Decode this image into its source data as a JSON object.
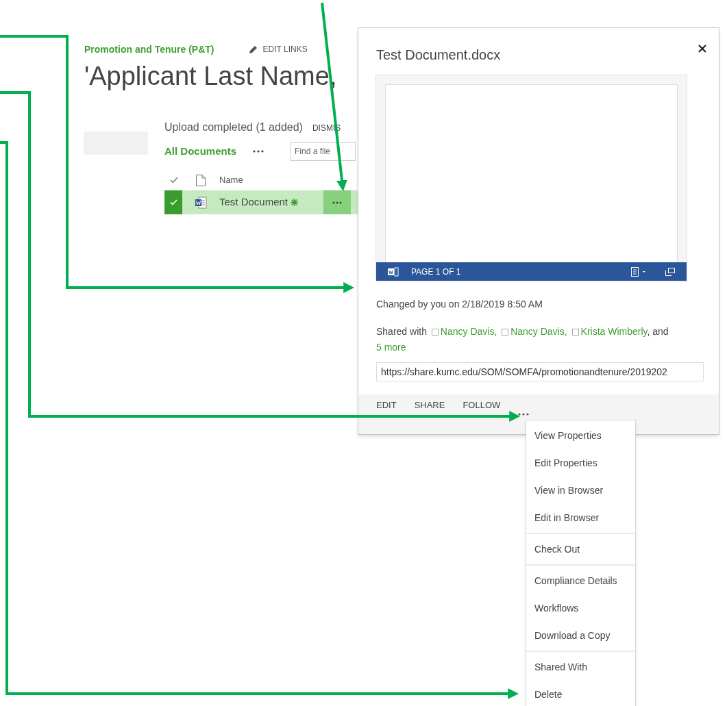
{
  "breadcrumb": {
    "site_link": "Promotion and Tenure (P&T)",
    "edit_links": "EDIT LINKS"
  },
  "page_title": "'Applicant Last Name,",
  "upload_status": {
    "message": "Upload completed (1 added)",
    "dismiss": "DISMIS"
  },
  "view": {
    "name": "All Documents",
    "search": {
      "placeholder": "Find a file"
    }
  },
  "table": {
    "columns": [
      "Name"
    ],
    "rows": [
      {
        "name": "Test Document",
        "selected": true,
        "new": true
      }
    ]
  },
  "callout": {
    "title": "Test Document.docx",
    "preview": {
      "page_label": "PAGE 1 OF 1"
    },
    "changed": "Changed by you on 2/18/2019 8:50 AM",
    "shared": {
      "prefix": "Shared with",
      "people": [
        "Nancy Davis,",
        "Nancy Davis,",
        "Krista Wimberly"
      ],
      "suffix": ", and",
      "more": "5 more"
    },
    "url": "https://share.kumc.edu/SOM/SOMFA/promotionandtenure/2019202",
    "actions": [
      "EDIT",
      "SHARE",
      "FOLLOW"
    ]
  },
  "menu": {
    "groups": [
      [
        "View Properties",
        "Edit Properties",
        "View in Browser",
        "Edit in Browser"
      ],
      [
        "Check Out"
      ],
      [
        "Compliance Details",
        "Workflows",
        "Download a Copy"
      ],
      [
        "Shared With",
        "Delete"
      ]
    ]
  }
}
